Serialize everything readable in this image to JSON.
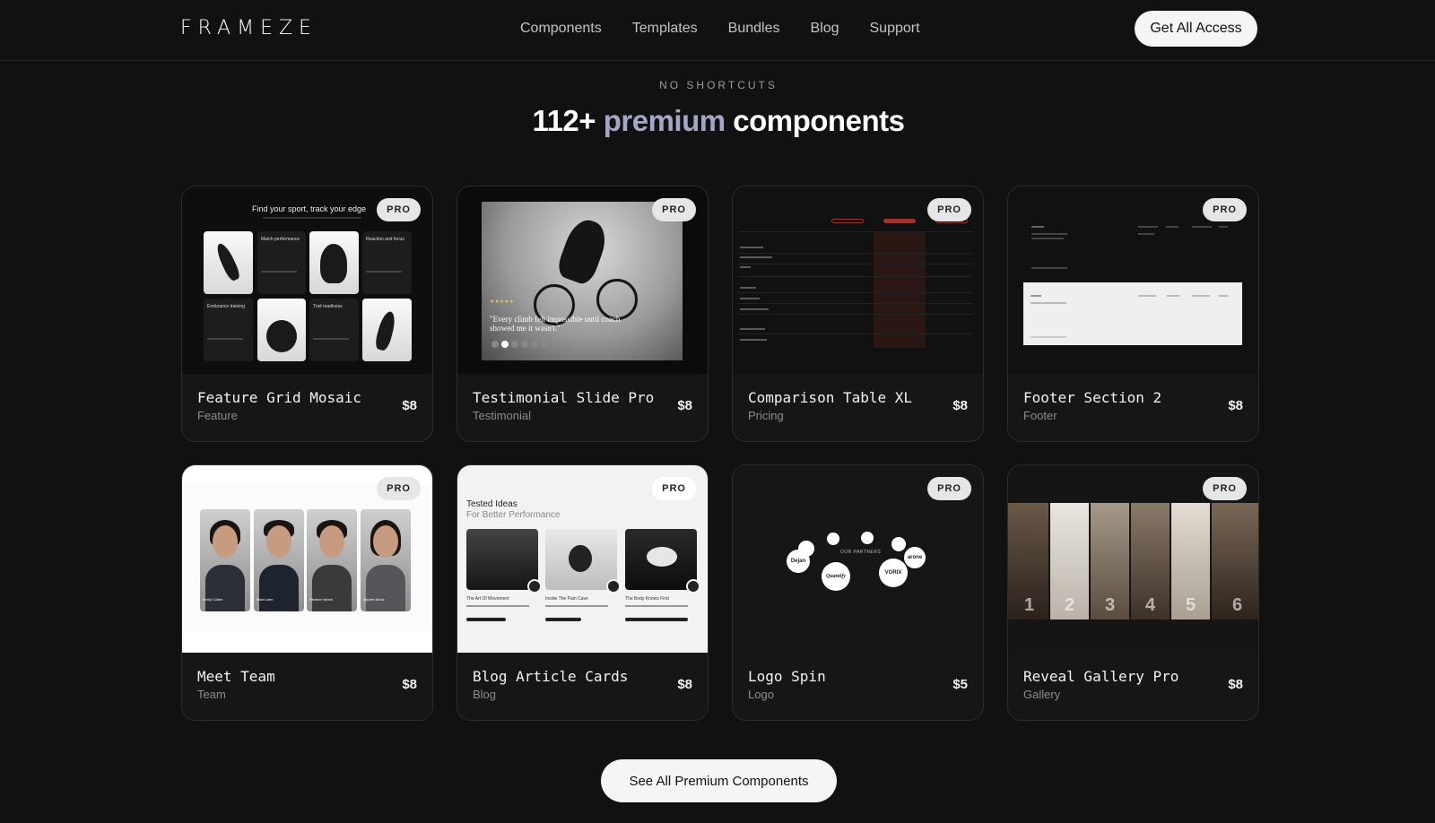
{
  "header": {
    "logo": "FRAMEZE",
    "nav": [
      "Components",
      "Templates",
      "Bundles",
      "Blog",
      "Support"
    ],
    "cta": "Get All Access"
  },
  "section": {
    "eyebrow": "NO SHORTCUTS",
    "title_prefix": "112+",
    "title_accent": "premium",
    "title_suffix": "components"
  },
  "cards": [
    {
      "name": "Feature Grid Mosaic",
      "category": "Feature",
      "price": "$8",
      "badge": "PRO",
      "thumb": {
        "title": "Find your sport, track your edge",
        "labels": [
          "Match performance",
          "Reaction and focus",
          "Endurance training",
          "Trail readiness"
        ]
      }
    },
    {
      "name": "Testimonial Slide Pro",
      "category": "Testimonial",
      "price": "$8",
      "badge": "PRO",
      "thumb": {
        "quote": "\"Every climb felt impossible until coach showed me it wasn't.\"",
        "stars": "★★★★★"
      }
    },
    {
      "name": "Comparison Table XL",
      "category": "Pricing",
      "price": "$8",
      "badge": "PRO"
    },
    {
      "name": "Footer Section 2",
      "category": "Footer",
      "price": "$8",
      "badge": "PRO"
    },
    {
      "name": "Meet Team",
      "category": "Team",
      "price": "$8",
      "badge": "PRO",
      "thumb": {
        "members": [
          "Emily Cullen",
          "Brad Lane",
          "Eleanor Vance",
          "Jayden Moss"
        ]
      }
    },
    {
      "name": "Blog Article Cards",
      "category": "Blog",
      "price": "$8",
      "badge": "PRO",
      "thumb": {
        "heading": "Tested Ideas",
        "subheading": "For Better Performance",
        "articles": [
          "The Art Of Movement",
          "Inside The Pain Cave",
          "The Body Knows First"
        ]
      }
    },
    {
      "name": "Logo Spin",
      "category": "Logo",
      "price": "$5",
      "badge": "PRO",
      "thumb": {
        "label": "OUR PARTNERS",
        "logos": [
          "Dejan",
          "Quantify",
          "VORIX",
          "arone"
        ]
      }
    },
    {
      "name": "Reveal Gallery Pro",
      "category": "Gallery",
      "price": "$8",
      "badge": "PRO",
      "thumb": {
        "numbers": [
          "1",
          "2",
          "3",
          "4",
          "5",
          "6"
        ]
      }
    }
  ],
  "footer_cta": "See All Premium Components",
  "colors": {
    "background": "#111111",
    "accent": "#a3a6c7",
    "button_bg": "#f5f5f5"
  }
}
